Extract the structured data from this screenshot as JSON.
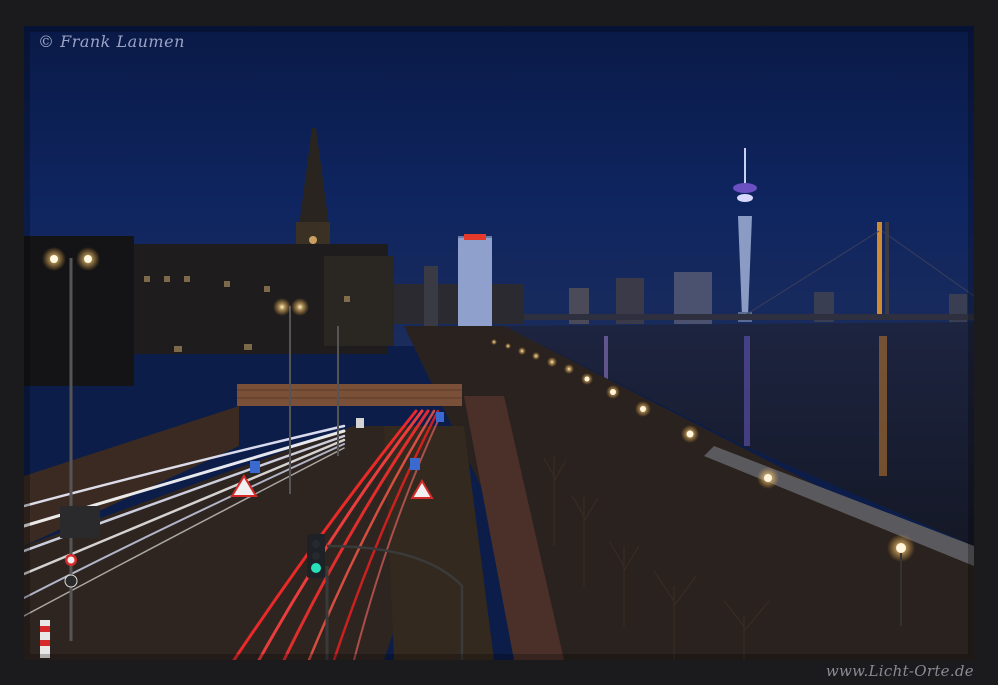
{
  "photo": {
    "copyright": "© Frank Laumen",
    "website": "www.Licht-Orte.de"
  }
}
